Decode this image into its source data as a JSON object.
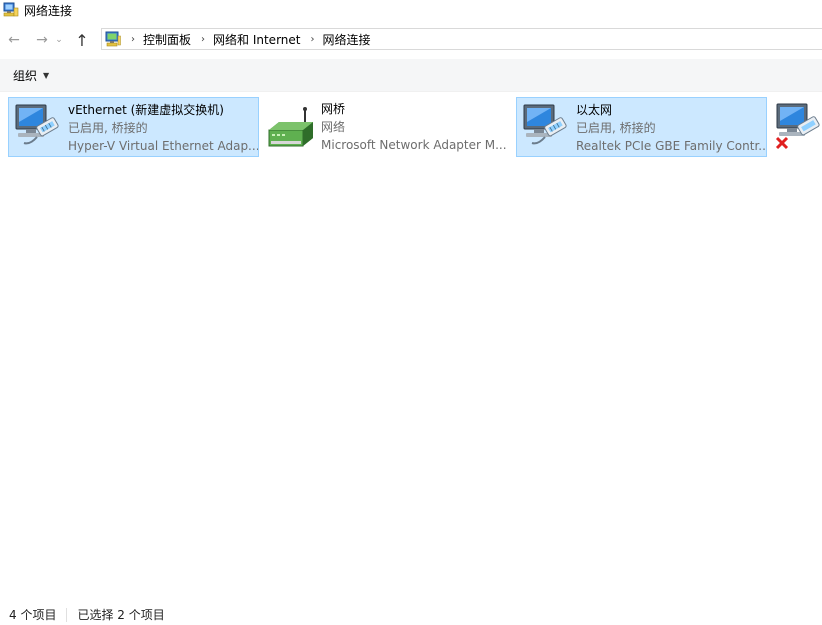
{
  "window": {
    "title": "网络连接"
  },
  "nav": {
    "back_glyph": "←",
    "forward_glyph": "→",
    "recent_glyph": "⌄",
    "up_glyph": "↑",
    "separator_glyph": "›",
    "breadcrumbs": [
      "控制面板",
      "网络和 Internet",
      "网络连接"
    ]
  },
  "toolbar": {
    "organize_label": "组织",
    "organize_caret": "▼"
  },
  "items": [
    {
      "name": "vEthernet (新建虚拟交换机)",
      "status": "已启用, 桥接的",
      "device": "Hyper-V Virtual Ethernet Adap...",
      "icon": "network-adapter-icon",
      "selected": true
    },
    {
      "name": "网桥",
      "status": "网络",
      "device": "Microsoft Network Adapter M...",
      "icon": "network-bridge-icon",
      "selected": false
    },
    {
      "name": "以太网",
      "status": "已启用, 桥接的",
      "device": "Realtek PCIe GBE Family Contr...",
      "icon": "network-adapter-icon",
      "selected": true
    },
    {
      "name": "",
      "status": "",
      "device": "",
      "icon": "network-adapter-disabled-icon",
      "selected": false
    }
  ],
  "status_bar": {
    "item_count": "4 个项目",
    "selected_count": "已选择 2 个项目"
  },
  "colors": {
    "selection_bg": "#cce8ff",
    "selection_border": "#99d1ff",
    "secondary_text": "#6d6d6d"
  }
}
